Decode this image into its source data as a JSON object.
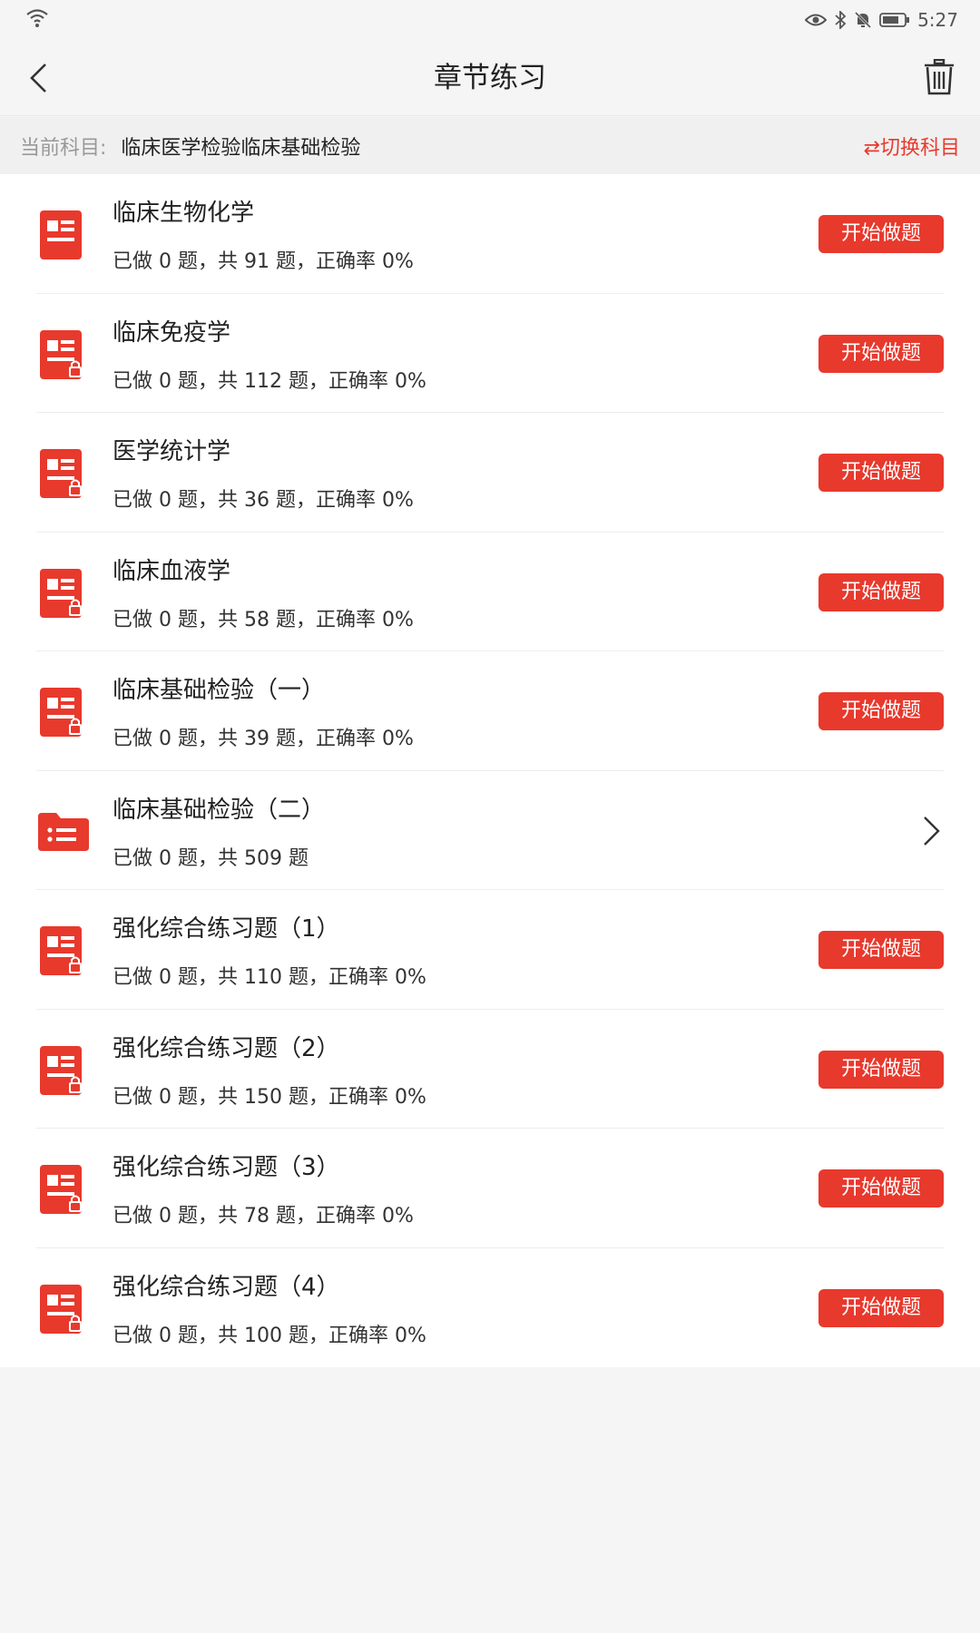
{
  "status_bar": {
    "time": "5:27"
  },
  "header": {
    "title": "章节练习"
  },
  "subject_bar": {
    "label": "当前科目:",
    "value": "临床医学检验临床基础检验",
    "switch_label": "⇄切换科目"
  },
  "colors": {
    "accent": "#e8392d",
    "background": "#f5f5f5"
  },
  "chapters": [
    {
      "title": "临床生物化学",
      "stats": "已做 0 题，共 91 题，正确率 0%",
      "action": "开始做题",
      "icon": "document-icon",
      "locked": false
    },
    {
      "title": "临床免疫学",
      "stats": "已做 0 题，共 112 题，正确率 0%",
      "action": "开始做题",
      "icon": "document-lock-icon",
      "locked": true
    },
    {
      "title": "医学统计学",
      "stats": "已做 0 题，共 36 题，正确率 0%",
      "action": "开始做题",
      "icon": "document-lock-icon",
      "locked": true
    },
    {
      "title": "临床血液学",
      "stats": "已做 0 题，共 58 题，正确率 0%",
      "action": "开始做题",
      "icon": "document-lock-icon",
      "locked": true
    },
    {
      "title": "临床基础检验（一）",
      "stats": "已做 0 题，共 39 题，正确率 0%",
      "action": "开始做题",
      "icon": "document-lock-icon",
      "locked": true
    },
    {
      "title": "临床基础检验（二）",
      "stats": "已做 0 题，共 509 题",
      "action": "",
      "icon": "folder-icon",
      "folder": true
    },
    {
      "title": "强化综合练习题（1）",
      "stats": "已做 0 题，共 110 题，正确率 0%",
      "action": "开始做题",
      "icon": "document-lock-icon",
      "locked": true
    },
    {
      "title": "强化综合练习题（2）",
      "stats": "已做 0 题，共 150 题，正确率 0%",
      "action": "开始做题",
      "icon": "document-lock-icon",
      "locked": true
    },
    {
      "title": "强化综合练习题（3）",
      "stats": "已做 0 题，共 78 题，正确率 0%",
      "action": "开始做题",
      "icon": "document-lock-icon",
      "locked": true
    },
    {
      "title": "强化综合练习题（4）",
      "stats": "已做 0 题，共 100 题，正确率 0%",
      "action": "开始做题",
      "icon": "document-lock-icon",
      "locked": true
    }
  ]
}
